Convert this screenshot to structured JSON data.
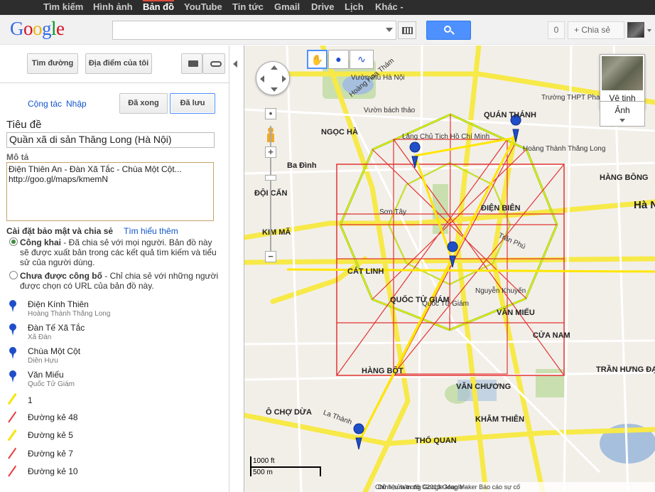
{
  "topbar": {
    "items": [
      "Tìm kiếm",
      "Hình ảnh",
      "Bản đồ",
      "YouTube",
      "Tin tức",
      "Gmail",
      "Drive",
      "Lịch",
      "Khác -"
    ],
    "active": "Bản đồ"
  },
  "header": {
    "logo": "Google",
    "search_value": "",
    "count": "0",
    "share": "+ Chia sẻ"
  },
  "toolbar": {
    "directions": "Tìm đường",
    "my_places": "Địa điểm của tôi"
  },
  "edit": {
    "collaborate": "Cộng tác",
    "import": "Nhập",
    "done": "Đã xong",
    "saved": "Đã lưu"
  },
  "form": {
    "title_label": "Tiêu đề",
    "title_value": "Quần xã di sản Thăng Long (Hà Nội)",
    "desc_label": "Mô tả",
    "desc_value": "Điện Thiên An - Đàn Xã Tắc - Chùa Một Cột...\nhttp://goo.gl/maps/kmemN",
    "privacy_label": "Cài đặt bảo mật và chia sẻ",
    "learn_more": "Tìm hiểu thêm",
    "public_title": "Công khai",
    "public_desc": " - Đã chia sẻ với mọi người. Bản đồ này sẽ được xuất bản trong các kết quả tìm kiếm và tiểu sử của người dùng.",
    "unlisted_title": "Chưa được công bố",
    "unlisted_desc": " - Chỉ chia sẻ với những người được chọn có URL của bản đồ này."
  },
  "features": [
    {
      "name": "Điện Kính Thiên",
      "sub": "Hoàng Thành Thăng Long",
      "kind": "pin"
    },
    {
      "name": "Đàn Tế Xã Tắc",
      "sub": "Xã Đàn",
      "kind": "pin"
    },
    {
      "name": "Chùa Một Cột",
      "sub": "Diên Hựu",
      "kind": "pin"
    },
    {
      "name": "Văn Miếu",
      "sub": "Quốc Tử Giám",
      "kind": "pin"
    },
    {
      "name": "1",
      "sub": "",
      "kind": "line",
      "color": "#f5e500"
    },
    {
      "name": "Đường kẻ 48",
      "sub": "",
      "kind": "line",
      "color": "#e84040"
    },
    {
      "name": "Đường kẻ 5",
      "sub": "",
      "kind": "line",
      "color": "#f5e500"
    },
    {
      "name": "Đường kẻ 7",
      "sub": "",
      "kind": "line",
      "color": "#e84040"
    },
    {
      "name": "Đường kẻ 10",
      "sub": "",
      "kind": "line",
      "color": "#e84040"
    }
  ],
  "map": {
    "satellite": "Vệ tinh",
    "terrain": "Ảnh",
    "scale_ft": "1000 ft",
    "scale_m": "500 m",
    "footer_data": "Dữ liệu bản đồ ©2013 Google -",
    "footer_edit": "Chỉnh sửa trong Google Map Maker",
    "footer_report": "Báo cáo sự cố",
    "labels": [
      {
        "t": "Hoàng Hoa Thám",
        "c": "normal"
      },
      {
        "t": "Vườn thú Hà Nội",
        "c": "normal"
      },
      {
        "t": "Vườn bách thảo",
        "c": "normal"
      },
      {
        "t": "QUÁN THÁNH",
        "c": "big"
      },
      {
        "t": "NGỌC HÀ",
        "c": "big"
      },
      {
        "t": "Ba Đình",
        "c": "big"
      },
      {
        "t": "ĐỘI CẤN",
        "c": "big"
      },
      {
        "t": "KIM MÃ",
        "c": "big"
      },
      {
        "t": "ĐIỆN BIÊN",
        "c": "big"
      },
      {
        "t": "CÁT LINH",
        "c": "big"
      },
      {
        "t": "QUỐC TỬ GIÁM",
        "c": "big"
      },
      {
        "t": "VĂN MIẾU",
        "c": "big"
      },
      {
        "t": "CỬA NAM",
        "c": "big"
      },
      {
        "t": "HÀNG BỘT",
        "c": "big"
      },
      {
        "t": "VĂN CHƯƠNG",
        "c": "big"
      },
      {
        "t": "KHÂM THIÊN",
        "c": "big"
      },
      {
        "t": "THỔ QUAN",
        "c": "big"
      },
      {
        "t": "Ô CHỢ DỪA",
        "c": "big"
      },
      {
        "t": "TRẦN HƯNG ĐẠO",
        "c": "big"
      },
      {
        "t": "HÀNG BÔNG",
        "c": "big"
      },
      {
        "t": "Lăng Chủ Tịch Hồ Chí Minh",
        "c": "normal"
      },
      {
        "t": "Trường THPT Phan Đình Phùng",
        "c": "normal"
      },
      {
        "t": "Hoàng Thành Thăng Long",
        "c": "normal"
      },
      {
        "t": "Sơn Tây",
        "c": "normal"
      },
      {
        "t": "Trần Phú",
        "c": "normal"
      },
      {
        "t": "Nguyễn Khuyến",
        "c": "normal"
      },
      {
        "t": "La Thành",
        "c": "normal"
      },
      {
        "t": "Hà Nội",
        "c": "normal"
      },
      {
        "t": "Quốc Tử Giám",
        "c": "normal"
      }
    ]
  },
  "colors": {
    "accent": "#4d90fe",
    "pin": "#1f4ec9",
    "road_yellow": "#f7e948",
    "overlay_yellow": "#ffe600",
    "overlay_red": "#e33333",
    "overlay_green": "#7ed03a"
  },
  "icons": [
    "search-icon",
    "keyboard-icon",
    "print-icon",
    "link-icon",
    "hand-icon",
    "marker-icon",
    "line-icon",
    "pegman-icon"
  ]
}
